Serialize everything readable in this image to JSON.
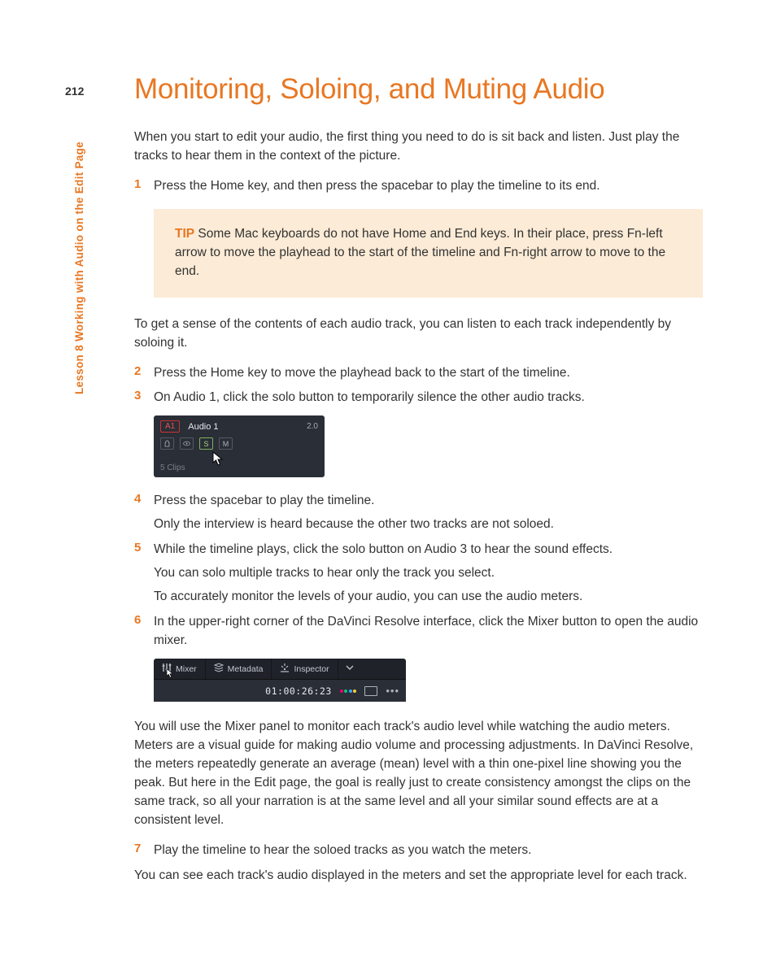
{
  "page_number": "212",
  "side_label": "Lesson 8   Working with Audio on the Edit Page",
  "title": "Monitoring, Soloing, and Muting Audio",
  "intro": "When you start to edit your audio, the first thing you need to do is sit back and listen. Just play the tracks to hear them in the context of the picture.",
  "steps": {
    "s1": "Press the Home key, and then press the spacebar to play the timeline to its end.",
    "s2": "Press the Home key to move the playhead back to the start of the timeline.",
    "s3": "On Audio 1, click the solo button to temporarily silence the other audio tracks.",
    "s4a": "Press the spacebar to play the timeline.",
    "s4b": "Only the interview is heard because the other two tracks are not soloed.",
    "s5a": "While the timeline plays, click the solo button on Audio 3 to hear the sound effects.",
    "s5b": "You can solo multiple tracks to hear only the track you select.",
    "s5c": "To accurately monitor the levels of your audio, you can use the audio meters.",
    "s6": "In the upper-right corner of the DaVinci Resolve interface, click the Mixer button to open the audio mixer.",
    "s7": "Play the timeline to hear the soloed tracks as you watch the meters."
  },
  "tip": {
    "label": "TIP",
    "text": "  Some Mac keyboards do not have Home and End keys. In their place, press Fn-left arrow to move the playhead to the start of the timeline and Fn-right arrow to move to the end."
  },
  "para_after_tip": "To get a sense of the contents of each audio track, you can listen to each track independently by soloing it.",
  "para_after_fig2": "You will use the Mixer panel to monitor each track's audio level while watching the audio meters. Meters are a visual guide for making audio volume and processing adjustments. In DaVinci Resolve, the meters repeatedly generate an average (mean) level with a thin one-pixel line showing you the peak. But here in the Edit page, the goal is really just to create consistency amongst the clips on the same track, so all your narration is at the same level and all your similar sound effects are at a consistent level.",
  "closing": "You can see each track's audio displayed in the meters and set the appropriate level for each track.",
  "fig_track": {
    "badge": "A1",
    "name": "Audio 1",
    "value": "2.0",
    "solo": "S",
    "mute": "M",
    "clips": "5 Clips"
  },
  "fig_mixer": {
    "tab_mixer": "Mixer",
    "tab_metadata": "Metadata",
    "tab_inspector": "Inspector",
    "timecode": "01:00:26:23"
  }
}
